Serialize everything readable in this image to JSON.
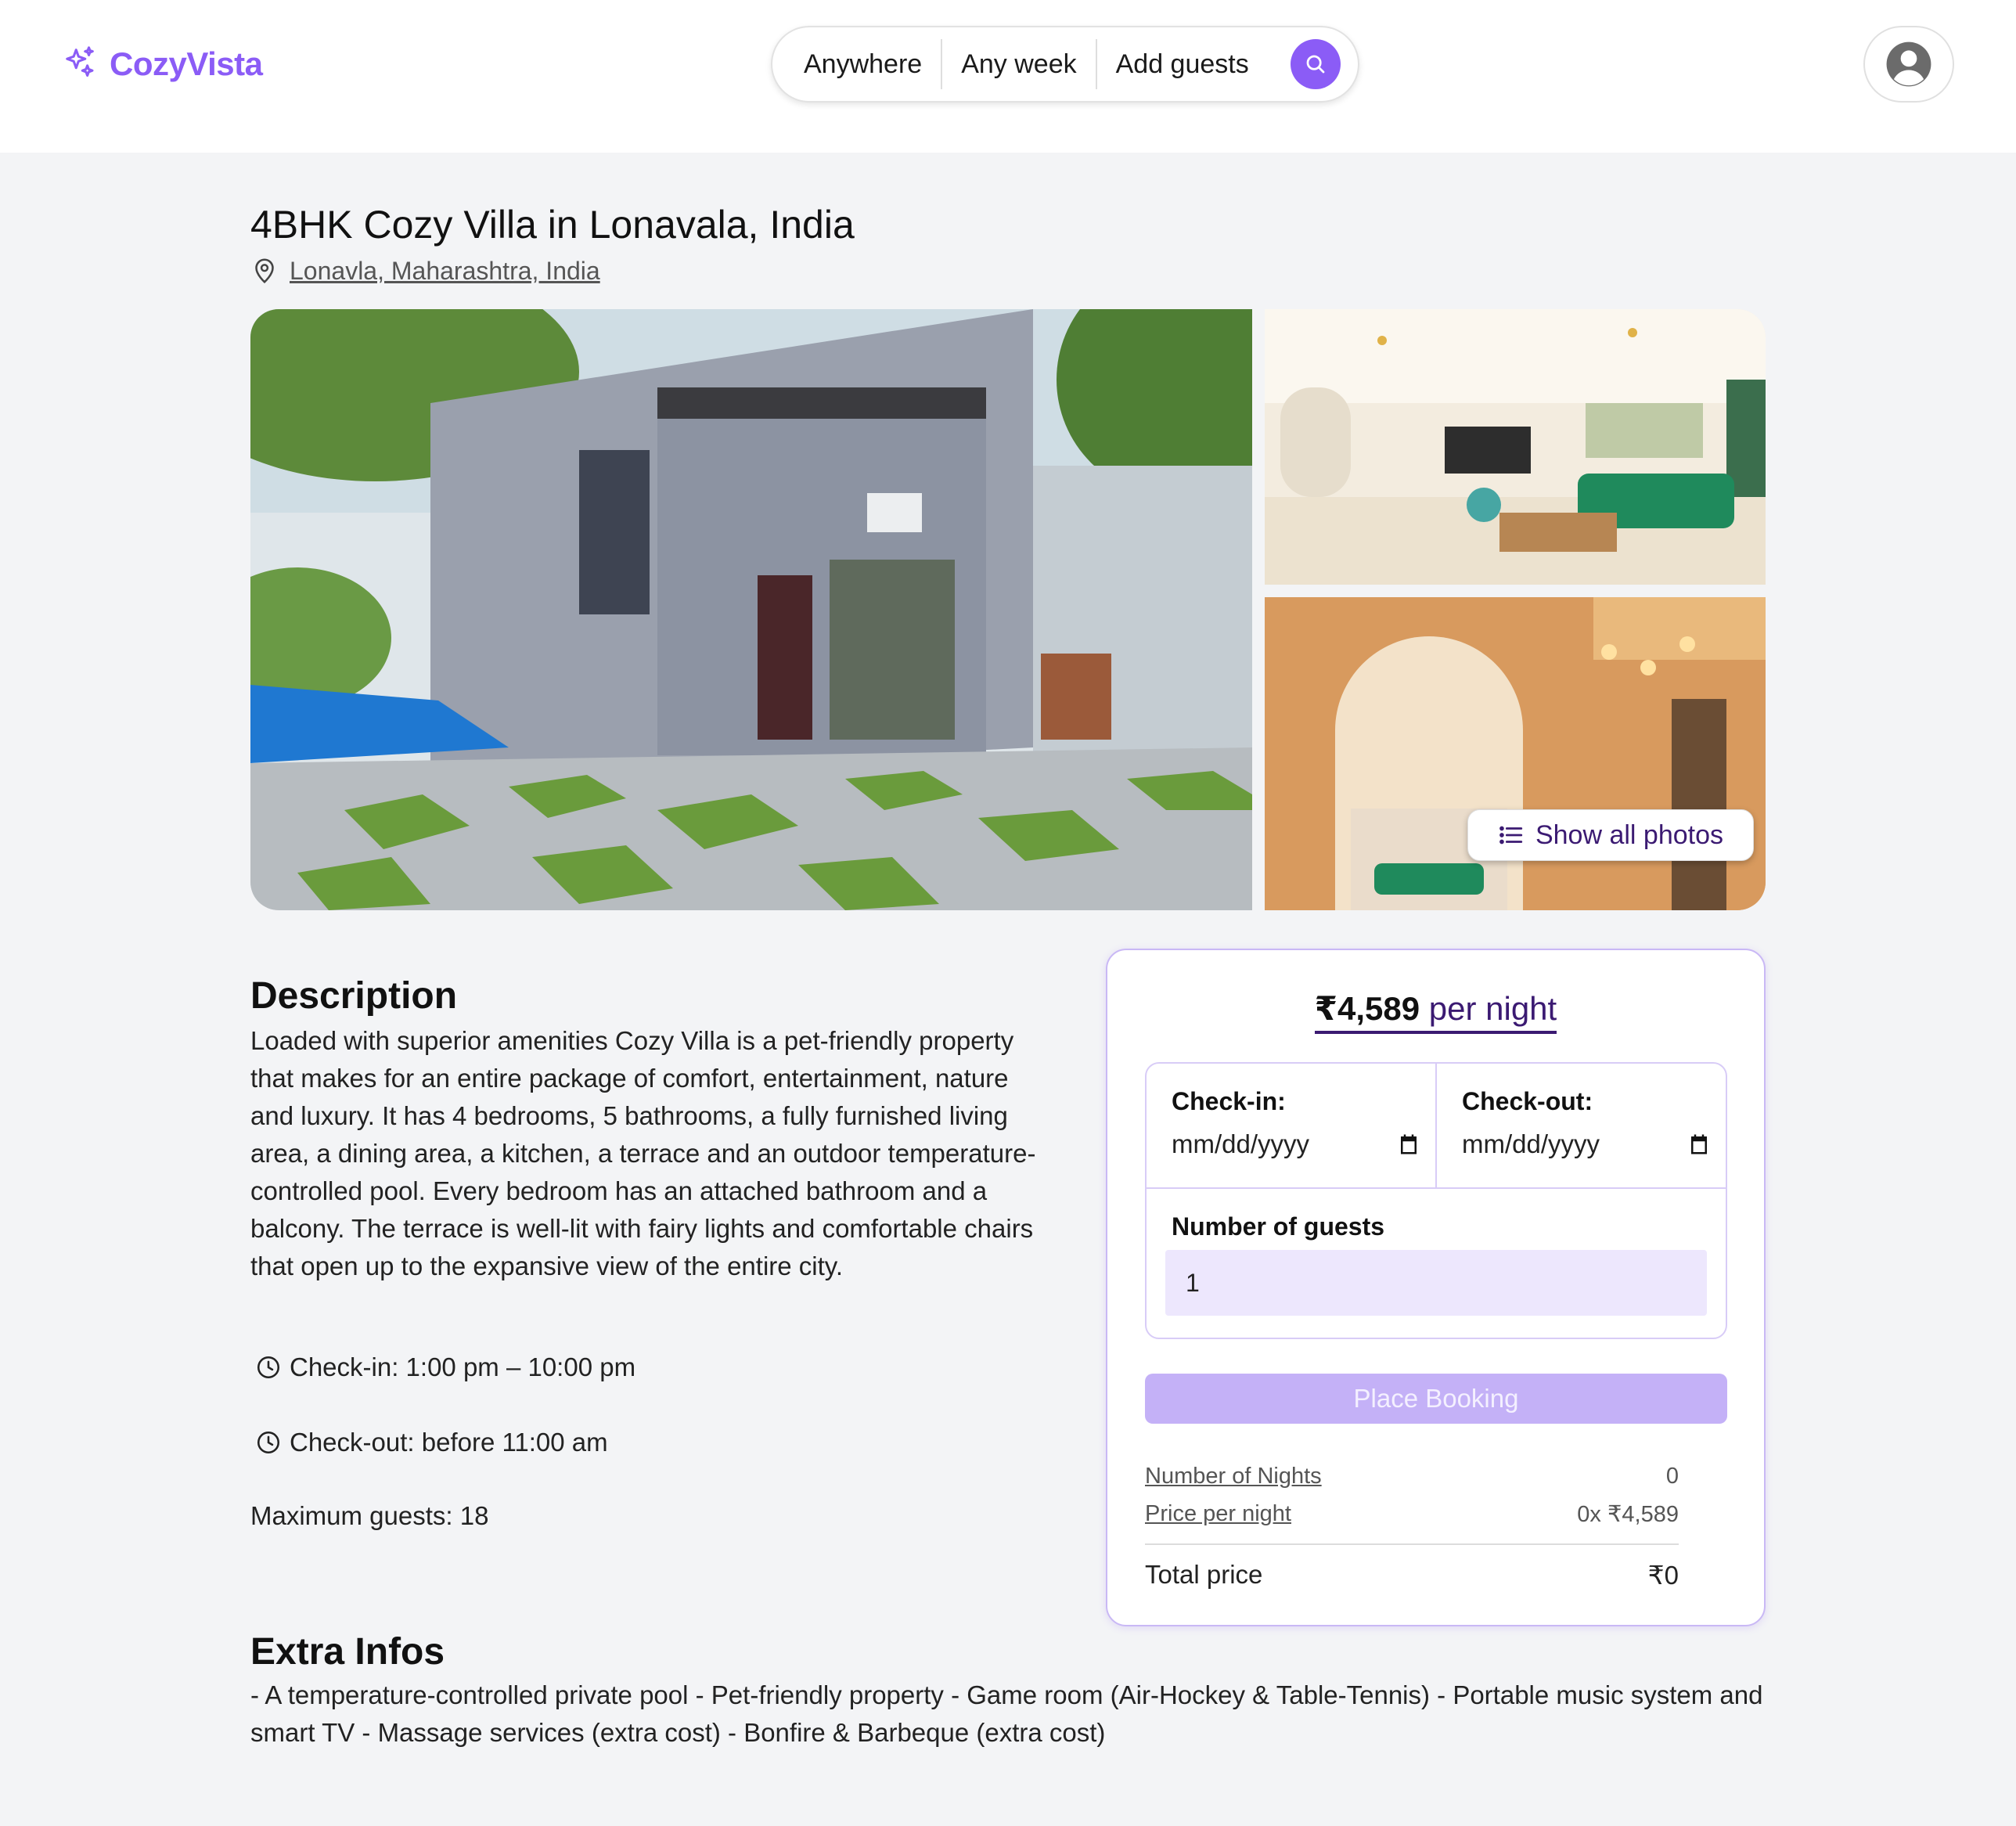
{
  "header": {
    "logo_text": "CozyVista",
    "search": {
      "where": "Anywhere",
      "when": "Any week",
      "who": "Add guests"
    },
    "accent_color": "#8b5cf6"
  },
  "listing": {
    "title": "4BHK Cozy Villa in Lonavala, India",
    "location": "Lonavla, Maharashtra, India",
    "show_photos_label": "Show all photos"
  },
  "description": {
    "heading": "Description",
    "text": "Loaded with superior amenities Cozy Villa is a pet-friendly property that makes for an entire package of comfort, entertainment, nature and luxury. It has 4 bedrooms, 5 bathrooms, a fully furnished living area, a dining area, a kitchen, a terrace and an outdoor temperature-controlled pool. Every bedroom has an attached bathroom and a balcony. The terrace is well-lit with fairy lights and comfortable chairs that open up to the expansive view of the entire city.",
    "checkin": "Check-in: 1:00 pm – 10:00 pm",
    "checkout": "Check-out: before 11:00 am",
    "max_guests": "Maximum guests: 18"
  },
  "extra": {
    "heading": "Extra Infos",
    "text": "- A temperature-controlled private pool - Pet-friendly property - Game room (Air-Hockey & Table-Tennis) - Portable music system and smart TV - Massage services (extra cost) - Bonfire & Barbeque (extra cost)"
  },
  "booking": {
    "price": "₹4,589",
    "price_unit": "per night",
    "checkin_label": "Check-in:",
    "checkout_label": "Check-out:",
    "date_placeholder": "mm/dd/yyyy",
    "guests_label": "Number of guests",
    "guests_value": "1",
    "place_booking_label": "Place Booking",
    "nights_label": "Number of Nights",
    "nights_value": "0",
    "ppn_label": "Price per night",
    "ppn_value": "0x ₹4,589",
    "total_label": "Total price",
    "total_value": "₹0"
  }
}
